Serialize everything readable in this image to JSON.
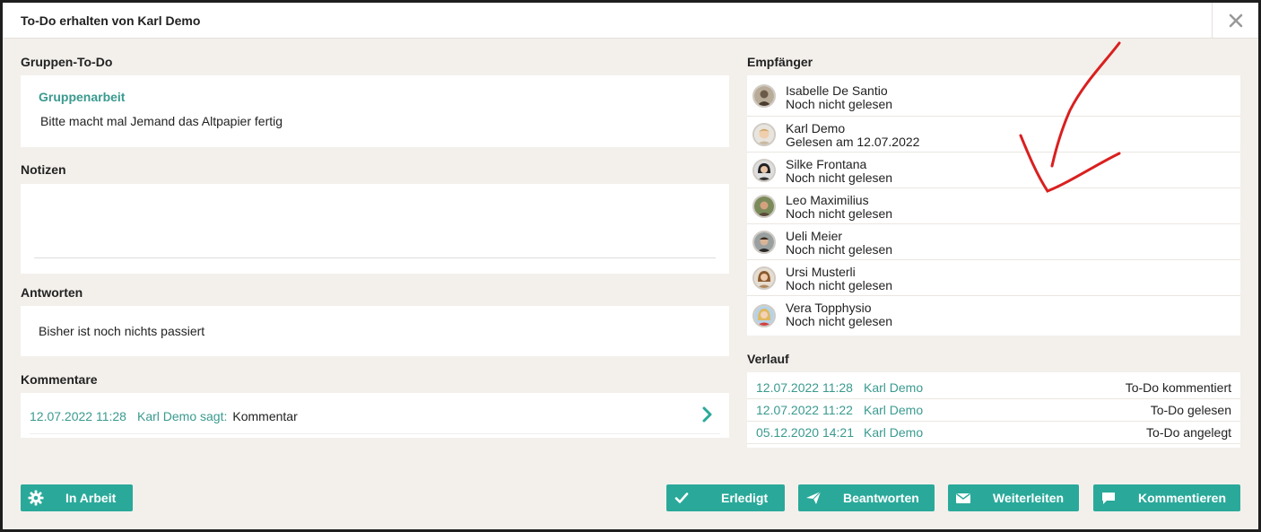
{
  "dialog": {
    "title": "To-Do erhalten von Karl Demo"
  },
  "group": {
    "label": "Gruppen-To-Do",
    "task_title": "Gruppenarbeit",
    "task_text": "Bitte macht mal Jemand das Altpapier fertig"
  },
  "notes": {
    "label": "Notizen"
  },
  "answers": {
    "label": "Antworten",
    "text": "Bisher ist noch nichts passiert"
  },
  "comments": {
    "label": "Kommentare",
    "items": [
      {
        "date": "12.07.2022 11:28",
        "user": "Karl Demo sagt:",
        "text": "Kommentar"
      }
    ]
  },
  "recipients": {
    "label": "Empfänger",
    "items": [
      {
        "name": "Isabelle De Santio",
        "status": "Noch nicht gelesen"
      },
      {
        "name": "Karl Demo",
        "status": "Gelesen am 12.07.2022"
      },
      {
        "name": "Silke Frontana",
        "status": "Noch nicht gelesen"
      },
      {
        "name": "Leo Maximilius",
        "status": "Noch nicht gelesen"
      },
      {
        "name": "Ueli  Meier",
        "status": "Noch nicht gelesen"
      },
      {
        "name": "Ursi Musterli",
        "status": "Noch nicht gelesen"
      },
      {
        "name": "Vera Topphysio",
        "status": "Noch nicht gelesen"
      }
    ]
  },
  "history": {
    "label": "Verlauf",
    "items": [
      {
        "date": "12.07.2022 11:28",
        "user": "Karl Demo",
        "action": "To-Do kommentiert"
      },
      {
        "date": "12.07.2022 11:22",
        "user": "Karl Demo",
        "action": "To-Do gelesen"
      },
      {
        "date": "05.12.2020 14:21",
        "user": "Karl Demo",
        "action": "To-Do angelegt"
      }
    ]
  },
  "buttons": {
    "in_progress": "In Arbeit",
    "done": "Erledigt",
    "reply": "Beantworten",
    "forward": "Weiterleiten",
    "comment": "Kommentieren"
  },
  "colors": {
    "accent": "#2aa99a",
    "link": "#3a9a8f",
    "background": "#f3f0ec",
    "annotation": "#d9201f"
  }
}
